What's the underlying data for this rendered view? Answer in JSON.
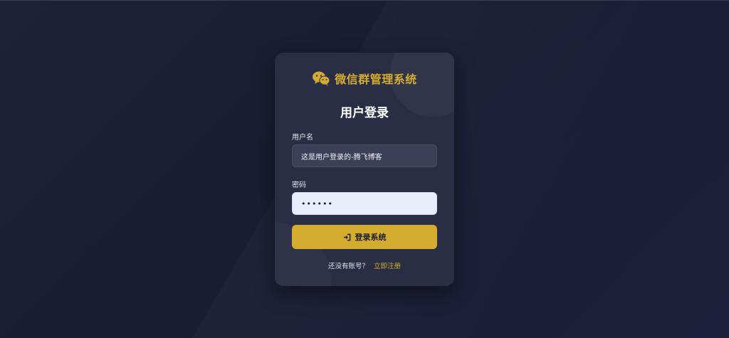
{
  "app": {
    "brand_text": "微信群管理系统",
    "brand_icon": "wechat-icon",
    "accent_color": "#d4ad30"
  },
  "login": {
    "title": "用户登录",
    "username_label": "用户名",
    "username_value": "这是用户登录的-腾飞博客",
    "password_label": "密码",
    "password_value": "••••••",
    "submit_label": "登录系统",
    "submit_icon": "sign-in-icon",
    "register_prompt": "还没有账号？",
    "register_link": "立即注册"
  }
}
